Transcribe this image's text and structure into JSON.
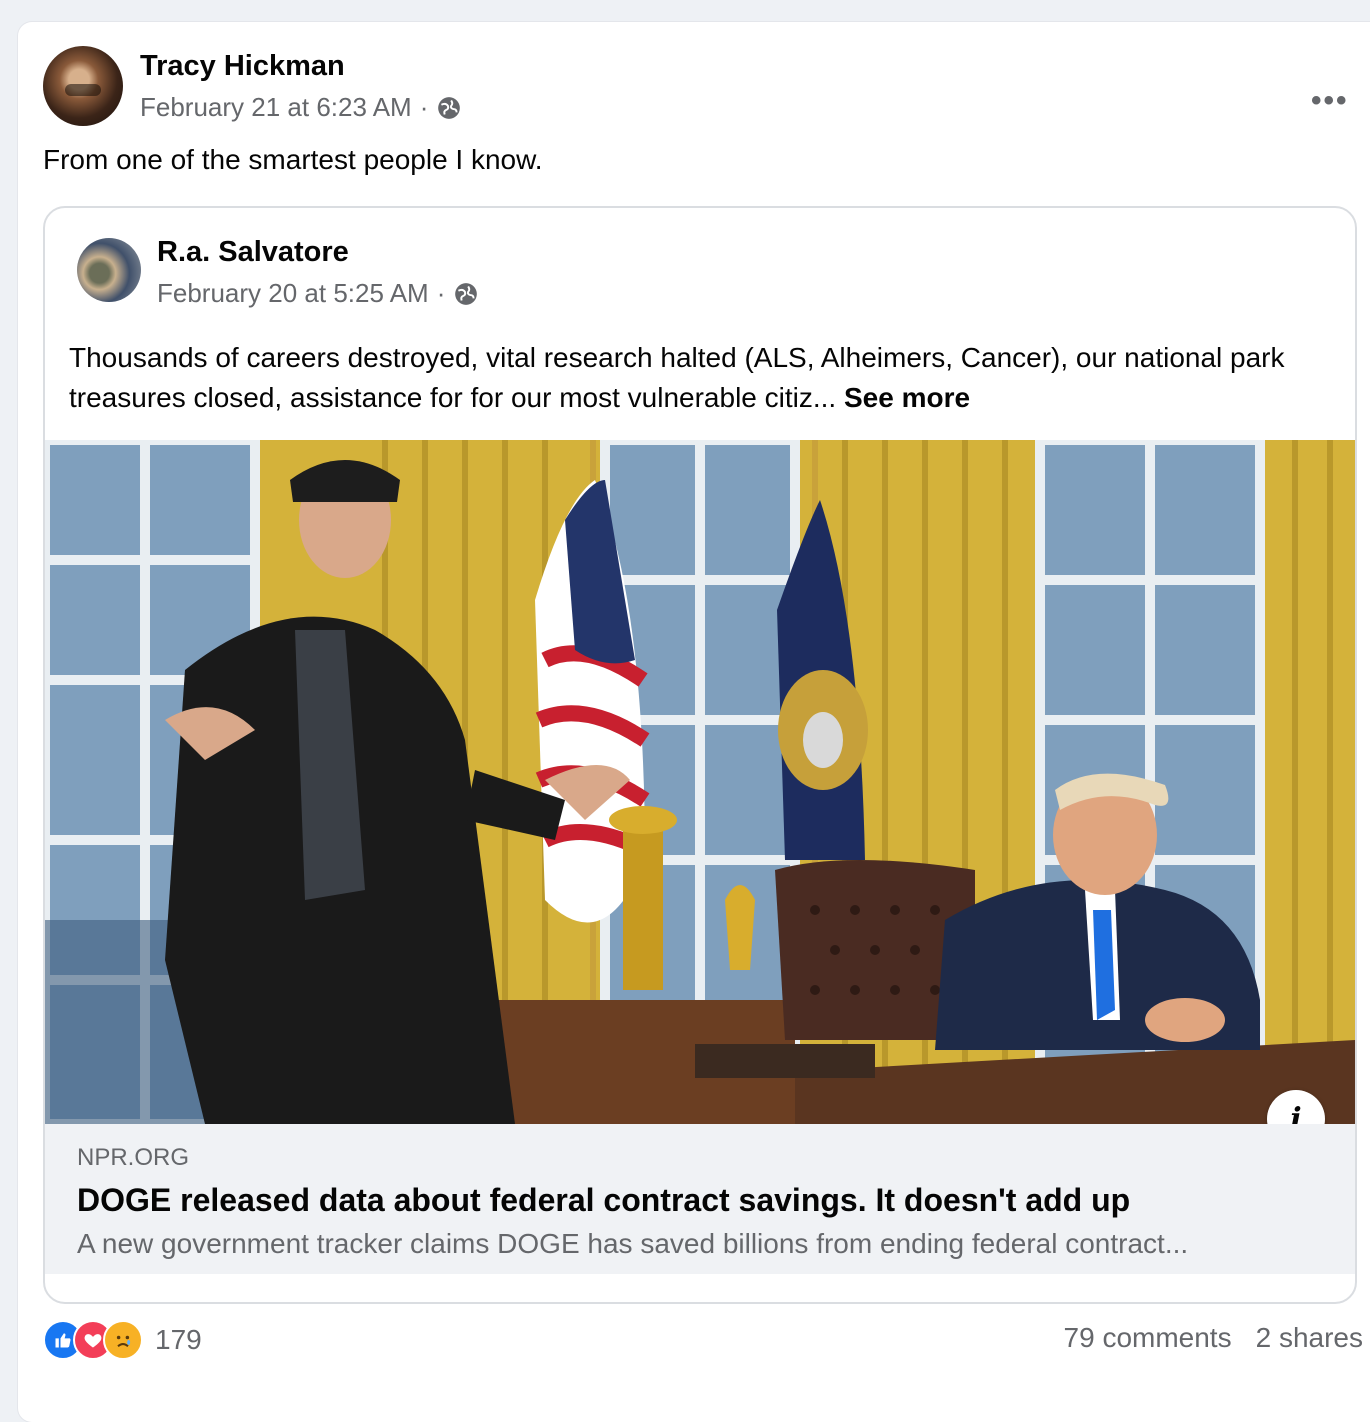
{
  "post": {
    "author": "Tracy Hickman",
    "timestamp": "February 21 at 6:23 AM",
    "separator": "·",
    "privacy_icon": "globe-icon",
    "more_label": "•••",
    "text": "From one of the smartest people I know."
  },
  "shared_post": {
    "author": "R.a. Salvatore",
    "timestamp": "February 20 at 5:25 AM",
    "separator": "·",
    "privacy_icon": "globe-icon",
    "text": "Thousands of careers destroyed, vital research halted (ALS, Alheimers, Cancer), our national park treasures closed, assistance for for our most vulnerable citiz...",
    "see_more": "See more",
    "link": {
      "domain": "NPR.ORG",
      "headline": "DOGE released data about federal contract savings. It doesn't add up",
      "description": "A new government tracker claims DOGE has saved billions from ending federal contract...",
      "info_label": "i"
    }
  },
  "footer": {
    "reactions": [
      {
        "type": "like",
        "icon": "like-icon"
      },
      {
        "type": "love",
        "icon": "heart-icon"
      },
      {
        "type": "sad",
        "icon": "sad-face-icon"
      }
    ],
    "reaction_count": "179",
    "comments": "79 comments",
    "shares": "2 shares"
  },
  "colors": {
    "accent": "#1877f2",
    "love": "#f33e58",
    "sad": "#f7b125",
    "muted_text": "#65676b",
    "link_bar": "#f0f2f5"
  }
}
